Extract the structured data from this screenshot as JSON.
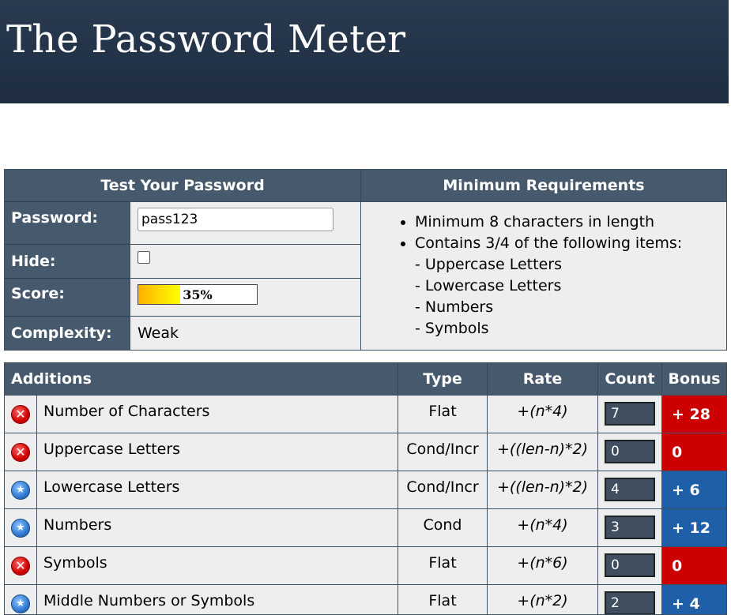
{
  "header": {
    "title": "The Password Meter"
  },
  "test": {
    "heading": "Test Your Password",
    "password_label": "Password:",
    "password_value": "pass123",
    "hide_label": "Hide:",
    "score_label": "Score:",
    "score_text": "35%",
    "score_value": 0.35,
    "complexity_label": "Complexity:",
    "complexity_value": "Weak"
  },
  "requirements": {
    "heading": "Minimum Requirements",
    "items": [
      "Minimum 8 characters in length",
      "Contains 3/4 of the following items:"
    ],
    "sub_items": [
      "- Uppercase Letters",
      "- Lowercase Letters",
      "- Numbers",
      "- Symbols"
    ]
  },
  "additions": {
    "headers": [
      "Additions",
      "Type",
      "Rate",
      "Count",
      "Bonus"
    ],
    "rows": [
      {
        "status": "fail",
        "icon": "fail-x-icon",
        "name": "Number of Characters",
        "type": "Flat",
        "rate": "+(n*4)",
        "count": "7",
        "bonus": "+ 28"
      },
      {
        "status": "fail",
        "icon": "fail-x-icon",
        "name": "Uppercase Letters",
        "type": "Cond/Incr",
        "rate": "+((len-n)*2)",
        "count": "0",
        "bonus": "0"
      },
      {
        "status": "pass",
        "icon": "pass-star-icon",
        "name": "Lowercase Letters",
        "type": "Cond/Incr",
        "rate": "+((len-n)*2)",
        "count": "4",
        "bonus": "+ 6"
      },
      {
        "status": "pass",
        "icon": "pass-star-icon",
        "name": "Numbers",
        "type": "Cond",
        "rate": "+(n*4)",
        "count": "3",
        "bonus": "+ 12"
      },
      {
        "status": "fail",
        "icon": "fail-x-icon",
        "name": "Symbols",
        "type": "Flat",
        "rate": "+(n*6)",
        "count": "0",
        "bonus": "0"
      },
      {
        "status": "pass",
        "icon": "pass-star-icon",
        "name": "Middle Numbers or Symbols",
        "type": "Flat",
        "rate": "+(n*2)",
        "count": "2",
        "bonus": "+ 4"
      }
    ]
  },
  "colors": {
    "fail_bonus": "#cc0000",
    "pass_bonus": "#1f5fa8",
    "header_bg": "#475a6d"
  }
}
